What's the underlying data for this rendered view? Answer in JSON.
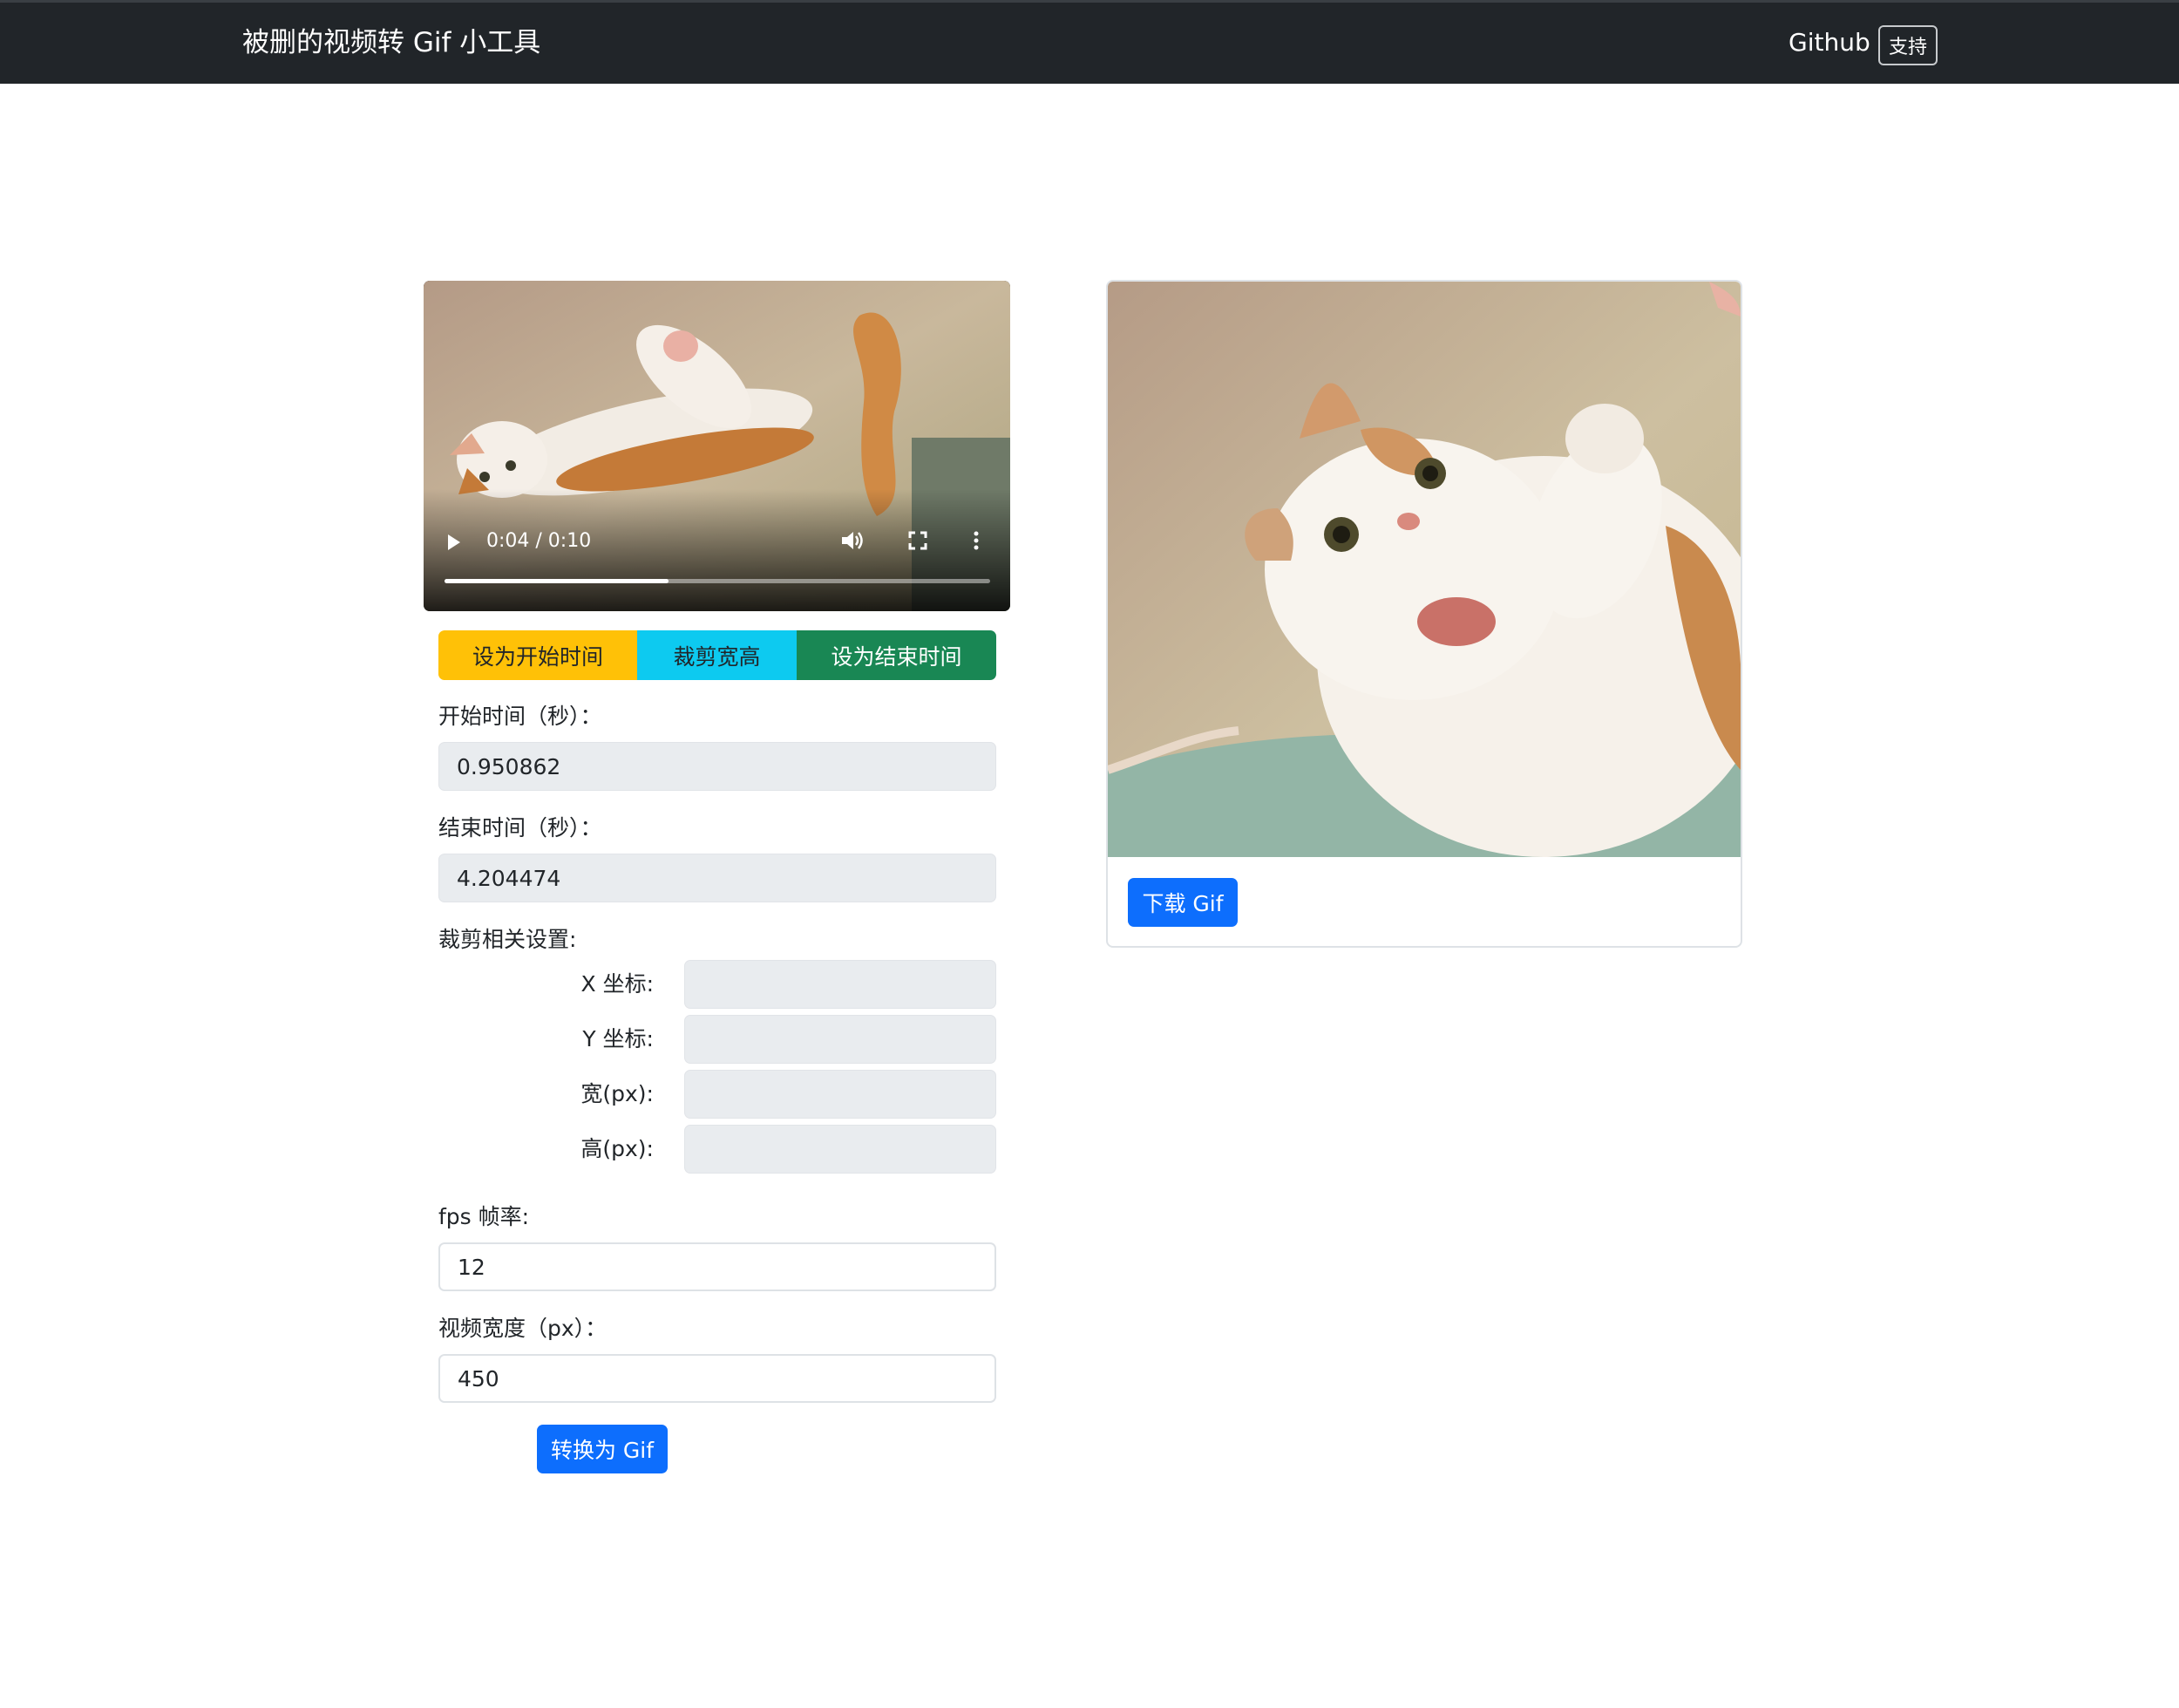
{
  "navbar": {
    "brand": "被删的视频转 Gif 小工具",
    "github_link": "Github",
    "support_button": "支持"
  },
  "video": {
    "time_display": "0:04 / 0:10",
    "progress_fraction": 0.41,
    "icons": [
      "play-icon",
      "volume-icon",
      "fullscreen-icon",
      "more-options-icon"
    ]
  },
  "buttons": {
    "set_start": "设为开始时间",
    "crop_size": "裁剪宽高",
    "set_end": "设为结束时间",
    "convert": "转换为 Gif",
    "download": "下载 Gif"
  },
  "form": {
    "start_label": "开始时间（秒）：",
    "start_value": "0.950862",
    "end_label": "结束时间（秒）：",
    "end_value": "4.204474",
    "crop_label": "裁剪相关设置:",
    "crop": {
      "x_label": "X 坐标:",
      "y_label": "Y 坐标:",
      "w_label": "宽(px):",
      "h_label": "高(px):"
    },
    "fps_label": "fps 帧率:",
    "fps_value": "12",
    "width_label": "视频宽度（px）：",
    "width_value": "450"
  },
  "colors": {
    "navbar_bg": "#212529",
    "warning": "#ffc107",
    "info": "#0dcaf0",
    "success": "#198754",
    "primary": "#0d6efd",
    "readonly_bg": "#e9ecef"
  }
}
